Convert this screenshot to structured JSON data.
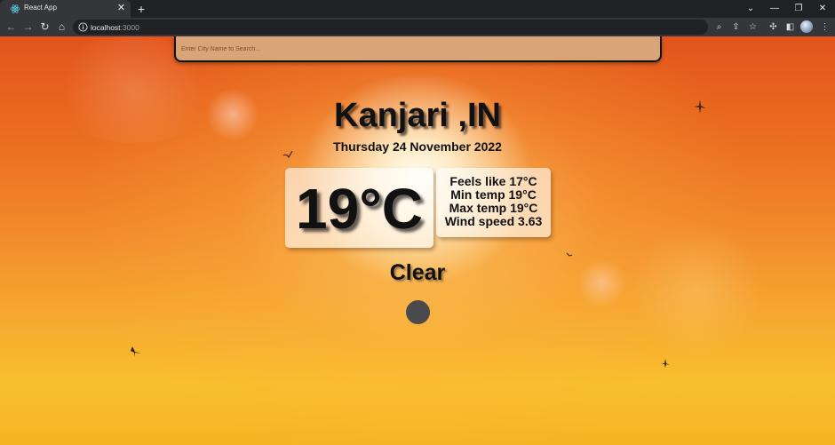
{
  "browser": {
    "tab": {
      "title": "React App",
      "favicon": "react-logo-icon"
    },
    "address": {
      "host": "localhost",
      "port": ":3000"
    },
    "window_controls": [
      "chevron-down-icon",
      "minimize-icon",
      "restore-icon",
      "close-icon"
    ],
    "toolbar_icons": [
      "zoom-icon",
      "share-icon",
      "bookmark-star-icon",
      "extensions-icon",
      "side-panel-icon",
      "profile-avatar",
      "more-menu-icon"
    ]
  },
  "search": {
    "placeholder": "Enter City Name to Search..."
  },
  "weather": {
    "city": "Kanjari ,IN",
    "date": "Thursday 24 November 2022",
    "temperature": "19°C",
    "feels_like": "Feels like 17°C",
    "min_temp": "Min temp 19°C",
    "max_temp": "Max temp 19°C",
    "wind_speed": "Wind speed 3.63",
    "condition": "Clear",
    "condition_icon": "clear-weather-icon"
  },
  "colors": {
    "sky_top": "#e2541c",
    "sky_bottom": "#f8bf2c",
    "search_bg": "#d9a578",
    "text": "#111111"
  }
}
